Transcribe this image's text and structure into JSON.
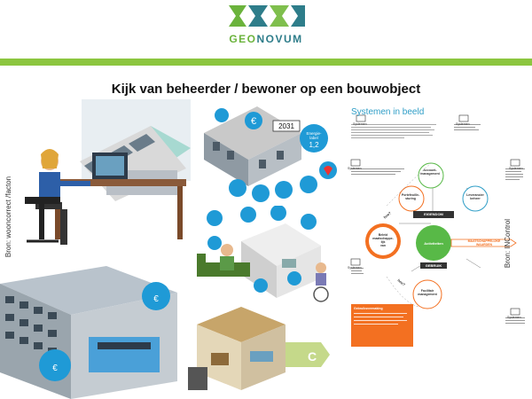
{
  "header": {
    "brand_part1": "GEO",
    "brand_part2": "NOVUM",
    "title": "Kijk van beheerder / bewoner op een bouwobject"
  },
  "sources": {
    "left": "Bron: wooncorrect /facton",
    "right": "Bron: INControl"
  },
  "illustrations": {
    "badge_year": "2031",
    "badge_energy": "Energie-\nlabel\n1,2",
    "label_c": "C",
    "icon_euro": "€"
  },
  "systemen": {
    "title": "Systemen in beeld",
    "labels": {
      "systemen": "Systemen",
      "portefeuille": "Portefeuille-\nsturing",
      "account": "Account-\nmanagement",
      "leverancier": "Leverancier\nbeheer",
      "eigendom": "EIGENDOM",
      "beleid": "Beleid\nmaatschappe-\nlijk\nvan",
      "activiteiten": "Activiteiten",
      "maatschappelijke": "MAATSCHAPPELIJKE\nWAARDEN",
      "gebruik": "GEBRUIK",
      "facilitair": "Facilitair\nmanagement",
      "hoe": "hoe?",
      "hoe2": "hoe?"
    },
    "orange_box_head": "Gebruiksvermaking"
  },
  "colors": {
    "green_band": "#8cc63f",
    "brand_teal": "#2e7d8a",
    "brand_green": "#6bb33c",
    "sys_blue": "#2f9ec7",
    "sys_orange": "#f37021",
    "sys_green": "#58b947"
  }
}
